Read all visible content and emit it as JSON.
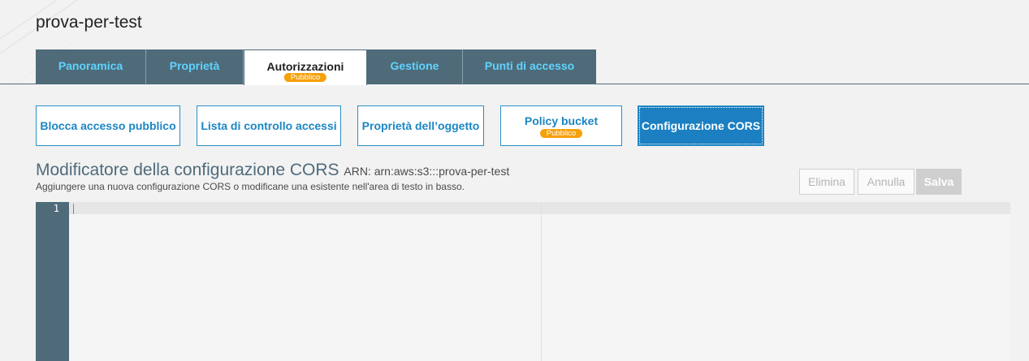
{
  "bucket": {
    "name": "prova-per-test"
  },
  "tabs": [
    {
      "label": "Panoramica"
    },
    {
      "label": "Proprietà"
    },
    {
      "label": "Autorizzazioni",
      "badge": "Pubblico"
    },
    {
      "label": "Gestione"
    },
    {
      "label": "Punti di accesso"
    }
  ],
  "subtabs": [
    {
      "label": "Blocca accesso pubblico"
    },
    {
      "label": "Lista di controllo accessi"
    },
    {
      "label": "Proprietà dell’oggetto"
    },
    {
      "label": "Policy bucket",
      "badge": "Pubblico"
    },
    {
      "label": "Configurazione CORS"
    }
  ],
  "editor": {
    "title": "Modificatore della configurazione CORS",
    "arn": "ARN: arn:aws:s3:::prova-per-test",
    "description": "Aggiungere una nuova configurazione CORS o modificane una esistente nell'area di testo in basso.",
    "line_number": "1",
    "content": ""
  },
  "buttons": {
    "delete": "Elimina",
    "cancel": "Annulla",
    "save": "Salva"
  },
  "colors": {
    "tab_bg": "#4f6b7a",
    "accent": "#1b86c3",
    "badge": "#f5a10b"
  }
}
